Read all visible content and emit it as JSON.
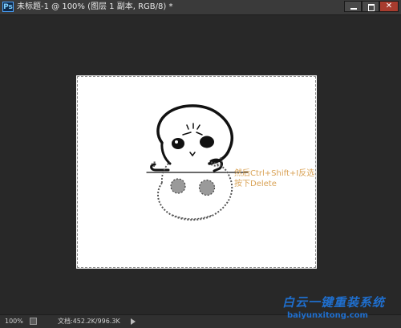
{
  "app": {
    "icon_label": "Ps",
    "title": "未标题-1 @ 100% (图层 1 副本, RGB/8) *",
    "window_controls": {
      "close_glyph": "✕"
    }
  },
  "document": {
    "annotation_line1": "然后Ctrl+Shift+I反选",
    "annotation_line2": "按下Delete",
    "annotation_color": "#d9a255"
  },
  "status_bar": {
    "zoom": "100%",
    "doc_info": "文档:452.2K/996.3K"
  },
  "watermark": {
    "text": "白云一键重装系统",
    "url": "baiyunxitong.com",
    "color": "#1f6fcf"
  }
}
